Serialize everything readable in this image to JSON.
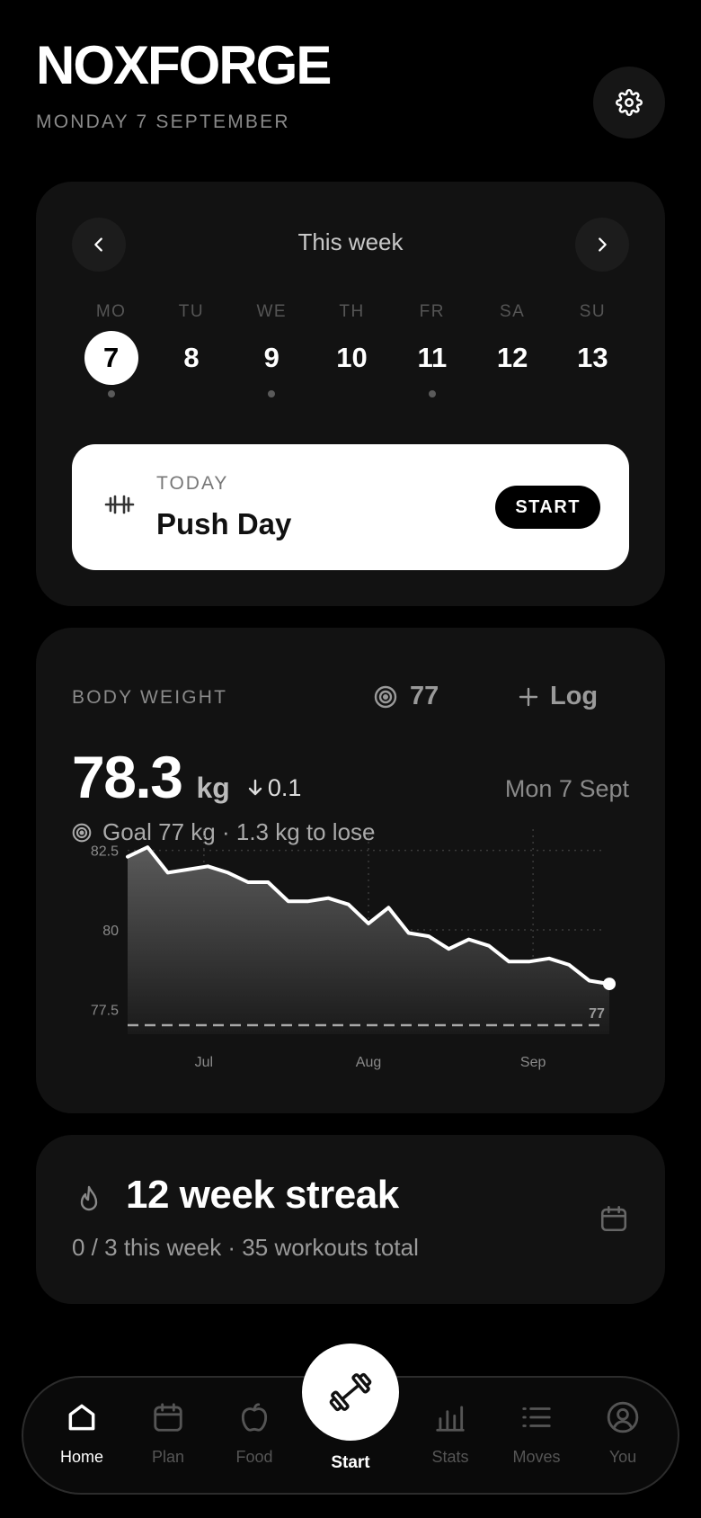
{
  "app": {
    "title": "NOXFORGE",
    "date": "MONDAY 7 SEPTEMBER"
  },
  "week": {
    "title": "This week",
    "days": [
      {
        "abbr": "MO",
        "num": "7",
        "active": true,
        "dot": true
      },
      {
        "abbr": "TU",
        "num": "8",
        "active": false,
        "dot": false
      },
      {
        "abbr": "WE",
        "num": "9",
        "active": false,
        "dot": true
      },
      {
        "abbr": "TH",
        "num": "10",
        "active": false,
        "dot": false
      },
      {
        "abbr": "FR",
        "num": "11",
        "active": false,
        "dot": true
      },
      {
        "abbr": "SA",
        "num": "12",
        "active": false,
        "dot": false
      },
      {
        "abbr": "SU",
        "num": "13",
        "active": false,
        "dot": false
      }
    ],
    "today_label": "TODAY",
    "today_workout": "Push Day",
    "start_label": "START"
  },
  "body_weight": {
    "label": "BODY WEIGHT",
    "target": "77",
    "log_label": "Log",
    "value": "78.3",
    "unit": "kg",
    "delta": "0.1",
    "date": "Mon 7 Sept",
    "goal_text": "Goal 77 kg · 1.3 kg to lose"
  },
  "chart_data": {
    "type": "area",
    "x_ticks": [
      "Jul",
      "Aug",
      "Sep"
    ],
    "y_ticks": [
      "82.5",
      "80",
      "77.5"
    ],
    "ylim": [
      77.0,
      83.0
    ],
    "goal_value": 77,
    "goal_label": "77",
    "grid": true,
    "values": [
      82.3,
      82.6,
      81.8,
      81.9,
      82.0,
      81.8,
      81.5,
      81.5,
      80.9,
      80.9,
      81.0,
      80.8,
      80.2,
      80.7,
      79.9,
      79.8,
      79.4,
      79.7,
      79.5,
      79.0,
      79.0,
      79.1,
      78.9,
      78.4,
      78.3
    ]
  },
  "streak": {
    "title": "12 week streak",
    "subtitle": "0 / 3 this week · 35 workouts total"
  },
  "tabs": [
    {
      "label": "Home",
      "icon": "home-icon"
    },
    {
      "label": "Plan",
      "icon": "calendar-icon"
    },
    {
      "label": "Food",
      "icon": "apple-icon"
    },
    {
      "label": "Start",
      "icon": "dumbbell-icon"
    },
    {
      "label": "Stats",
      "icon": "bar-chart-icon"
    },
    {
      "label": "Moves",
      "icon": "list-icon"
    },
    {
      "label": "You",
      "icon": "user-icon"
    }
  ]
}
